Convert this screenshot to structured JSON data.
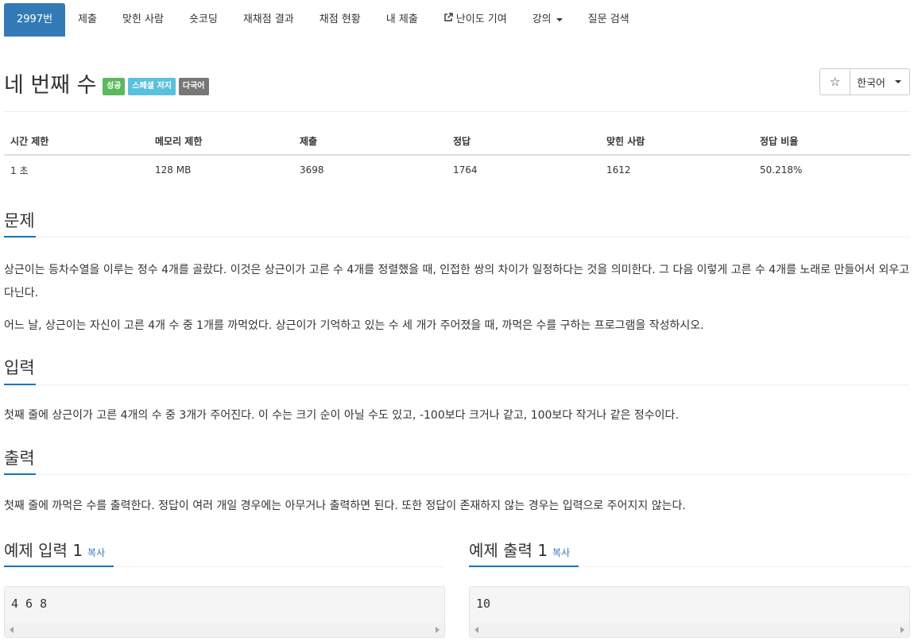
{
  "nav": {
    "tabs": [
      {
        "label": "2997번"
      },
      {
        "label": "제출"
      },
      {
        "label": "맞힌 사람"
      },
      {
        "label": "숏코딩"
      },
      {
        "label": "재채점 결과"
      },
      {
        "label": "채점 현황"
      },
      {
        "label": "내 제출"
      },
      {
        "label": "난이도 기여"
      },
      {
        "label": "강의"
      },
      {
        "label": "질문 검색"
      }
    ]
  },
  "problem": {
    "title": "네 번째 수",
    "badges": [
      "성공",
      "스페셜 저지",
      "다국어"
    ],
    "star": "☆",
    "language": "한국어"
  },
  "info": {
    "headers": [
      "시간 제한",
      "메모리 제한",
      "제출",
      "정답",
      "맞힌 사람",
      "정답 비율"
    ],
    "values": [
      "1 초",
      "128 MB",
      "3698",
      "1764",
      "1612",
      "50.218%"
    ]
  },
  "sections": {
    "problem_h": "문제",
    "problem_p1": "상근이는 등차수열을 이루는 정수 4개를 골랐다. 이것은 상근이가 고른 수 4개를 정렬했을 때, 인접한 쌍의 차이가 일정하다는 것을 의미한다. 그 다음 이렇게 고른 수 4개를 노래로 만들어서 외우고 다닌다.",
    "problem_p2": "어느 날, 상근이는 자신이 고른 4개 수 중 1개를 까먹었다. 상근이가 기억하고 있는 수 세 개가 주어졌을 때, 까먹은 수를 구하는 프로그램을 작성하시오.",
    "input_h": "입력",
    "input_p": "첫째 줄에 상근이가 고른 4개의 수 중 3개가 주어진다. 이 수는 크기 순이 아닐 수도 있고, -100보다 크거나 같고, 100보다 작거나 같은 정수이다.",
    "output_h": "출력",
    "output_p": "첫째 줄에 까먹은 수를 출력한다. 정답이 여러 개일 경우에는 아무거나 출력하면 된다. 또한 정답이 존재하지 않는 경우는 입력으로 주어지지 않는다."
  },
  "examples": {
    "input_h": "예제 입력 1",
    "output_h": "예제 출력 1",
    "copy": "복사",
    "input_code": "4 6 8",
    "output_code": "10"
  }
}
